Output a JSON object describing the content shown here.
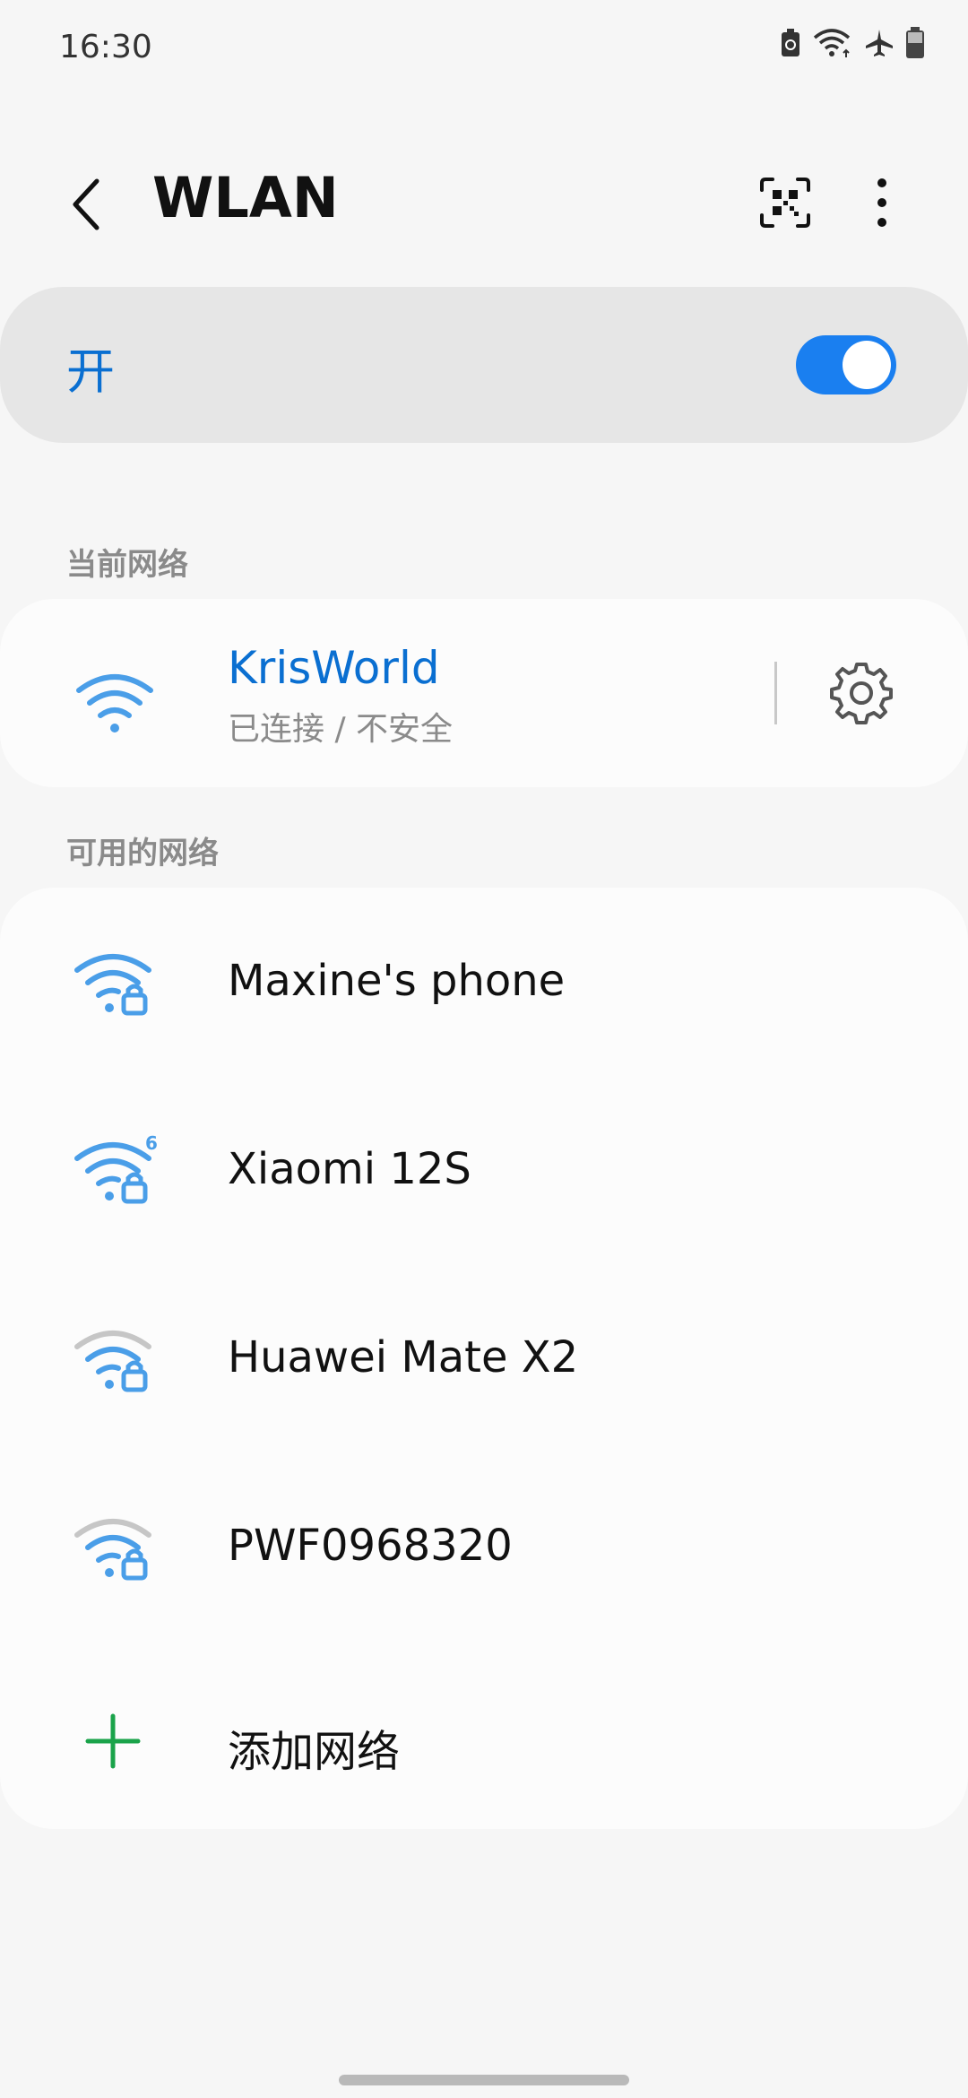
{
  "status_bar": {
    "time": "16:30",
    "icons": [
      "battery-saver-icon",
      "wifi-signal-icon",
      "airplane-icon",
      "battery-icon"
    ]
  },
  "app_bar": {
    "title": "WLAN",
    "back_icon": "chevron-left-icon",
    "qr_icon": "qr-scan-icon",
    "more_icon": "more-vert-icon"
  },
  "wifi_toggle": {
    "label": "开",
    "enabled": true,
    "accent": "#1a7ff0"
  },
  "current_network": {
    "section_label": "当前网络",
    "name": "KrisWorld",
    "status": "已连接 / 不安全",
    "icon": "wifi-icon",
    "settings_icon": "gear-icon"
  },
  "available_networks": {
    "section_label": "可用的网络",
    "items": [
      {
        "name": "Maxine's phone",
        "icon": "wifi-lock-icon",
        "signal_bars": 3,
        "wifi6": false
      },
      {
        "name": "Xiaomi 12S",
        "icon": "wifi6-lock-icon",
        "signal_bars": 3,
        "wifi6": true
      },
      {
        "name": "Huawei Mate X2",
        "icon": "wifi-lock-icon",
        "signal_bars": 2,
        "wifi6": false
      },
      {
        "name": "PWF0968320",
        "icon": "wifi-lock-icon",
        "signal_bars": 2,
        "wifi6": false
      }
    ],
    "add_label": "添加网络",
    "add_icon": "plus-icon"
  },
  "colors": {
    "blue": "#0a6fd1",
    "wifi_blue": "#4a9ee8",
    "wifi_gray": "#c6c6c6",
    "add_green": "#1aa34a"
  }
}
